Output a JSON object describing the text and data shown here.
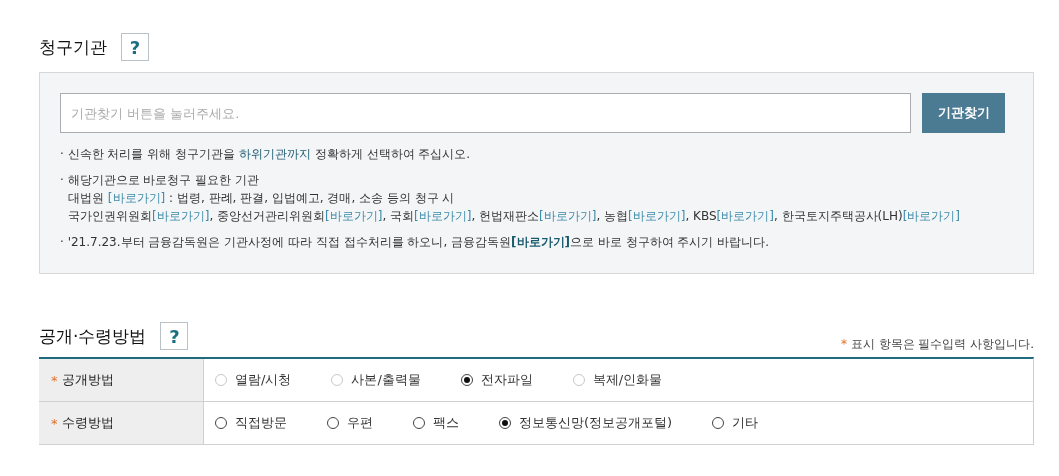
{
  "agency_section": {
    "title": "청구기관",
    "help": "?",
    "search": {
      "placeholder": "기관찾기 버튼을 눌러주세요."
    },
    "find_button": "기관찾기",
    "notes": [
      {
        "lines": [
          [
            {
              "kind": "text",
              "text": "· 신속한 처리를 위해 청구기관을 "
            },
            {
              "kind": "emphasis",
              "text": "하위기관까지"
            },
            {
              "kind": "text",
              "text": " 정확하게 선택하여 주십시오."
            }
          ]
        ]
      },
      {
        "lines": [
          [
            {
              "kind": "text",
              "text": "· 해당기관으로 바로청구 필요한 기관"
            }
          ],
          [
            {
              "kind": "text",
              "text": "대법원 "
            },
            {
              "kind": "link",
              "text": "[바로가기]"
            },
            {
              "kind": "text",
              "text": " : 법령, 판례, 판결, 입법예고, 경매, 소송 등의 청구 시"
            }
          ],
          [
            {
              "kind": "text",
              "text": "국가인권위원회"
            },
            {
              "kind": "link",
              "text": "[바로가기]"
            },
            {
              "kind": "text",
              "text": ", 중앙선거관리위원회"
            },
            {
              "kind": "link",
              "text": "[바로가기]"
            },
            {
              "kind": "text",
              "text": ", 국회"
            },
            {
              "kind": "link",
              "text": "[바로가기]"
            },
            {
              "kind": "text",
              "text": ", 헌법재판소"
            },
            {
              "kind": "link",
              "text": "[바로가기]"
            },
            {
              "kind": "text",
              "text": ", 농협"
            },
            {
              "kind": "link",
              "text": "[바로가기]"
            },
            {
              "kind": "text",
              "text": ", KBS"
            },
            {
              "kind": "link",
              "text": "[바로가기]"
            },
            {
              "kind": "text",
              "text": ", 한국토지주택공사(LH)"
            },
            {
              "kind": "link",
              "text": "[바로가기]"
            }
          ]
        ]
      },
      {
        "lines": [
          [
            {
              "kind": "text",
              "text": "· '21.7.23.부터 금융감독원은 기관사정에 따라 직접 접수처리를 하오니, 금융감독원"
            },
            {
              "kind": "strong-link",
              "text": "[바로가기]"
            },
            {
              "kind": "text",
              "text": "으로 바로 청구하여 주시기 바랍니다."
            }
          ]
        ]
      }
    ]
  },
  "method_section": {
    "title": "공개·수령방법",
    "help": "?",
    "required_note_mark": "*",
    "required_note": "표시 항목은 필수입력 사항입니다.",
    "rows": [
      {
        "mark": "*",
        "label": "공개방법",
        "options": [
          {
            "label": "열람/시청",
            "selected": false,
            "disabled": true
          },
          {
            "label": "사본/출력물",
            "selected": false,
            "disabled": true
          },
          {
            "label": "전자파일",
            "selected": true,
            "disabled": false
          },
          {
            "label": "복제/인화물",
            "selected": false,
            "disabled": true
          }
        ]
      },
      {
        "mark": "*",
        "label": "수령방법",
        "options": [
          {
            "label": "직접방문",
            "selected": false,
            "disabled": false
          },
          {
            "label": "우편",
            "selected": false,
            "disabled": false
          },
          {
            "label": "팩스",
            "selected": false,
            "disabled": false
          },
          {
            "label": "정보통신망(정보공개포털)",
            "selected": true,
            "disabled": false
          },
          {
            "label": "기타",
            "selected": false,
            "disabled": false
          }
        ]
      }
    ]
  }
}
